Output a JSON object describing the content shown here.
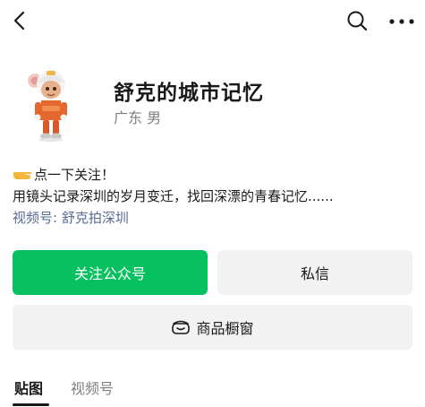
{
  "header": {
    "back_icon": "chevron-left-icon",
    "search_icon": "search-icon",
    "more_icon": "more-dots-icon"
  },
  "profile": {
    "name": "舒克的城市记忆",
    "region_gender": "广东 男",
    "avatar": "cartoon-character-avatar"
  },
  "intro": {
    "line1": "点一下关注！",
    "line2": "用镜头记录深圳的岁月变迁，找回深漂的青春记忆......",
    "channel": "视频号: 舒克拍深圳",
    "pointer_icon": "pointing-hand-emoji"
  },
  "actions": {
    "follow_label": "关注公众号",
    "message_label": "私信",
    "shop_label": "商品橱窗",
    "shop_icon": "shop-window-icon"
  },
  "tabs": [
    {
      "label": "贴图",
      "active": true
    },
    {
      "label": "视频号",
      "active": false
    }
  ],
  "colors": {
    "accent": "#07c160",
    "link": "#576b95",
    "button_gray": "#f2f2f2",
    "secondary_text": "#7f7f7f"
  }
}
